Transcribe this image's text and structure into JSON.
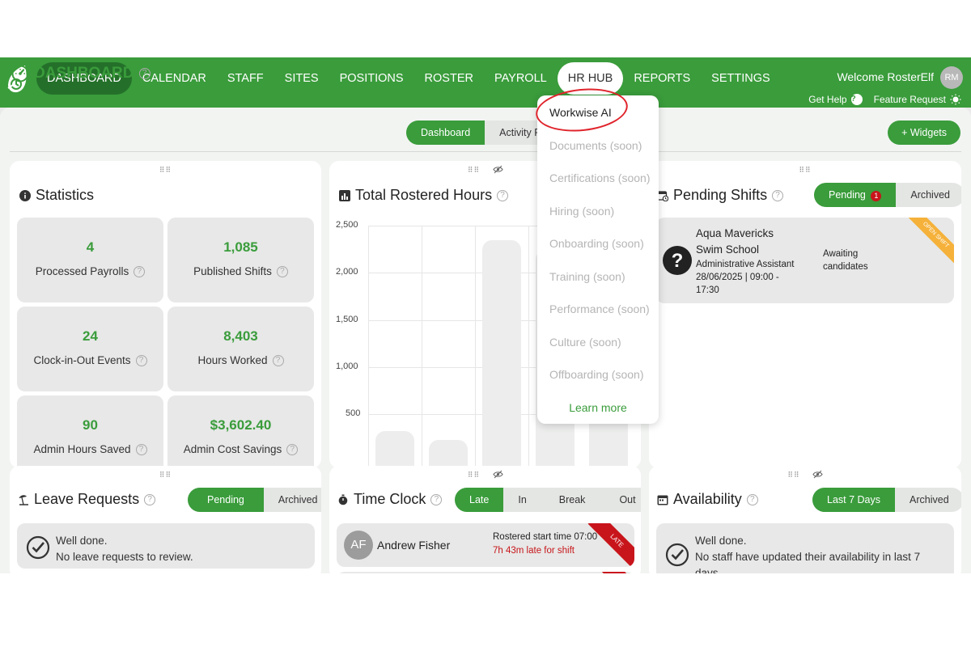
{
  "nav": {
    "items": [
      "DASHBOARD",
      "CALENDAR",
      "STAFF",
      "SITES",
      "POSITIONS",
      "ROSTER",
      "PAYROLL",
      "HR HUB",
      "REPORTS",
      "SETTINGS"
    ],
    "welcome": "Welcome RosterElf",
    "avatar": "RM",
    "get_help": "Get Help",
    "feature_request": "Feature Request"
  },
  "header": {
    "title": "DASHBOARD",
    "tabs": [
      "Dashboard",
      "Activity Fe"
    ],
    "widgets_button": "+ Widgets"
  },
  "statistics": {
    "title": "Statistics",
    "items": [
      {
        "value": "4",
        "label": "Processed Payrolls"
      },
      {
        "value": "1,085",
        "label": "Published Shifts"
      },
      {
        "value": "24",
        "label": "Clock-in-Out Events"
      },
      {
        "value": "8,403",
        "label": "Hours Worked"
      },
      {
        "value": "90",
        "label": "Admin Hours Saved"
      },
      {
        "value": "$3,602.40",
        "label": "Admin Cost Savings"
      }
    ]
  },
  "rostered_hours": {
    "title": "Total Rostered Hours",
    "y_ticks": [
      "2,500",
      "2,000",
      "1,500",
      "1,000",
      "500"
    ]
  },
  "pending_shifts": {
    "title": "Pending Shifts",
    "tabs": [
      "Pending",
      "Archived"
    ],
    "badge": "1",
    "shift": {
      "org_line1": "Aqua Mavericks",
      "org_line2": "Swim School",
      "position": "Administrative Assistant",
      "time_line1": "28/06/2025 | 09:00 -",
      "time_line2": "17:30",
      "status_line1": "Awaiting",
      "status_line2": "candidates",
      "ribbon": "OPEN SHIFT"
    }
  },
  "leave_requests": {
    "title": "Leave Requests",
    "tabs": [
      "Pending",
      "Archived"
    ],
    "message_line1": "Well done.",
    "message_line2": "No leave requests to review."
  },
  "time_clock": {
    "title": "Time Clock",
    "tabs": [
      "Late",
      "In",
      "Break",
      "Out"
    ],
    "row": {
      "initials": "AF",
      "name": "Andrew Fisher",
      "start": "Rostered start time 07:00",
      "late": "7h 43m late for shift",
      "ribbon": "LATE"
    }
  },
  "availability": {
    "title": "Availability",
    "tabs": [
      "Last 7 Days",
      "Archived"
    ],
    "message_line1": "Well done.",
    "message_line2": "No staff have updated their availability in last 7",
    "message_line3": "days."
  },
  "hr_dropdown": {
    "items": [
      "Workwise AI",
      "Documents (soon)",
      "Certifications (soon)",
      "Hiring (soon)",
      "Onboarding (soon)",
      "Training (soon)",
      "Performance (soon)",
      "Culture (soon)",
      "Offboarding (soon)"
    ],
    "learn_more": "Learn more"
  },
  "colors": {
    "brand_green": "#3a9c3b",
    "dark_green": "#24702a",
    "late_red": "#c8151b",
    "open_shift_orange": "#f5b13a",
    "highlight_circle": "#e0242c"
  }
}
